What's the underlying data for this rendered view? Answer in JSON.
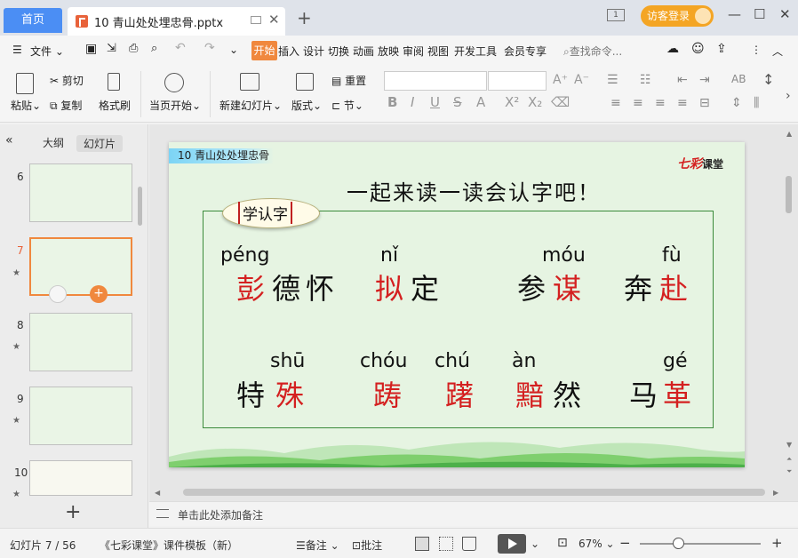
{
  "tabs": {
    "home": "首页",
    "document": "10 青山处处埋忠骨.pptx",
    "new_tab": "+"
  },
  "title_bar": {
    "one_badge": "1",
    "visitor_login": "访客登录"
  },
  "menu": {
    "file": "文件",
    "items": [
      "开始",
      "插入",
      "设计",
      "切换",
      "动画",
      "放映",
      "审阅",
      "视图",
      "开发工具",
      "会员专享"
    ],
    "search_placeholder": "查找命令..."
  },
  "ribbon": {
    "paste": "粘贴",
    "cut": "剪切",
    "copy": "复制",
    "format_painter": "格式刷",
    "play_from_current": "当页开始",
    "new_slide": "新建幻灯片",
    "layout": "版式",
    "reset": "重置",
    "section": "节",
    "font_value": "",
    "size_value": ""
  },
  "sidebar": {
    "tab_outline": "大纲",
    "tab_slides": "幻灯片",
    "slide_numbers": [
      "6",
      "7",
      "8",
      "9",
      "10"
    ]
  },
  "slide": {
    "tag": "10 青山处处埋忠骨",
    "logo_main": "七彩",
    "logo_sub": "课堂",
    "title": "一起来读一读会认字吧！",
    "badge": "学认字",
    "row1": [
      {
        "pinyin": "péng",
        "chars": [
          "彭",
          "德",
          "怀"
        ]
      },
      {
        "pinyin": "nǐ",
        "chars": [
          "拟",
          "定"
        ]
      },
      {
        "pinyin": "móu",
        "chars": [
          "参",
          "谋"
        ]
      },
      {
        "pinyin": "fù",
        "chars": [
          "奔",
          "赴"
        ]
      }
    ],
    "row2": [
      {
        "pinyin": "shū",
        "chars": [
          "特",
          "殊"
        ]
      },
      {
        "pinyin": "chóu",
        "chars": [
          "踌"
        ]
      },
      {
        "pinyin": "chú",
        "chars": [
          "躇"
        ]
      },
      {
        "pinyin": "àn",
        "chars": [
          "黯",
          "然"
        ]
      },
      {
        "pinyin": "gé",
        "chars": [
          "马",
          "革"
        ]
      }
    ],
    "highlight_color": "#d42020",
    "box_color": "#3a8a3a",
    "background_color": "#e6f4e2"
  },
  "notes": {
    "placeholder": "单击此处添加备注"
  },
  "status": {
    "slide_info": "幻灯片 7 / 56",
    "template": "《七彩课堂》课件模板（新）",
    "notes_btn": "备注",
    "comment_btn": "批注",
    "zoom": "67%"
  },
  "colors": {
    "accent": "#4b8ef4",
    "orange": "#f0883e",
    "visitor": "#f4a524"
  }
}
